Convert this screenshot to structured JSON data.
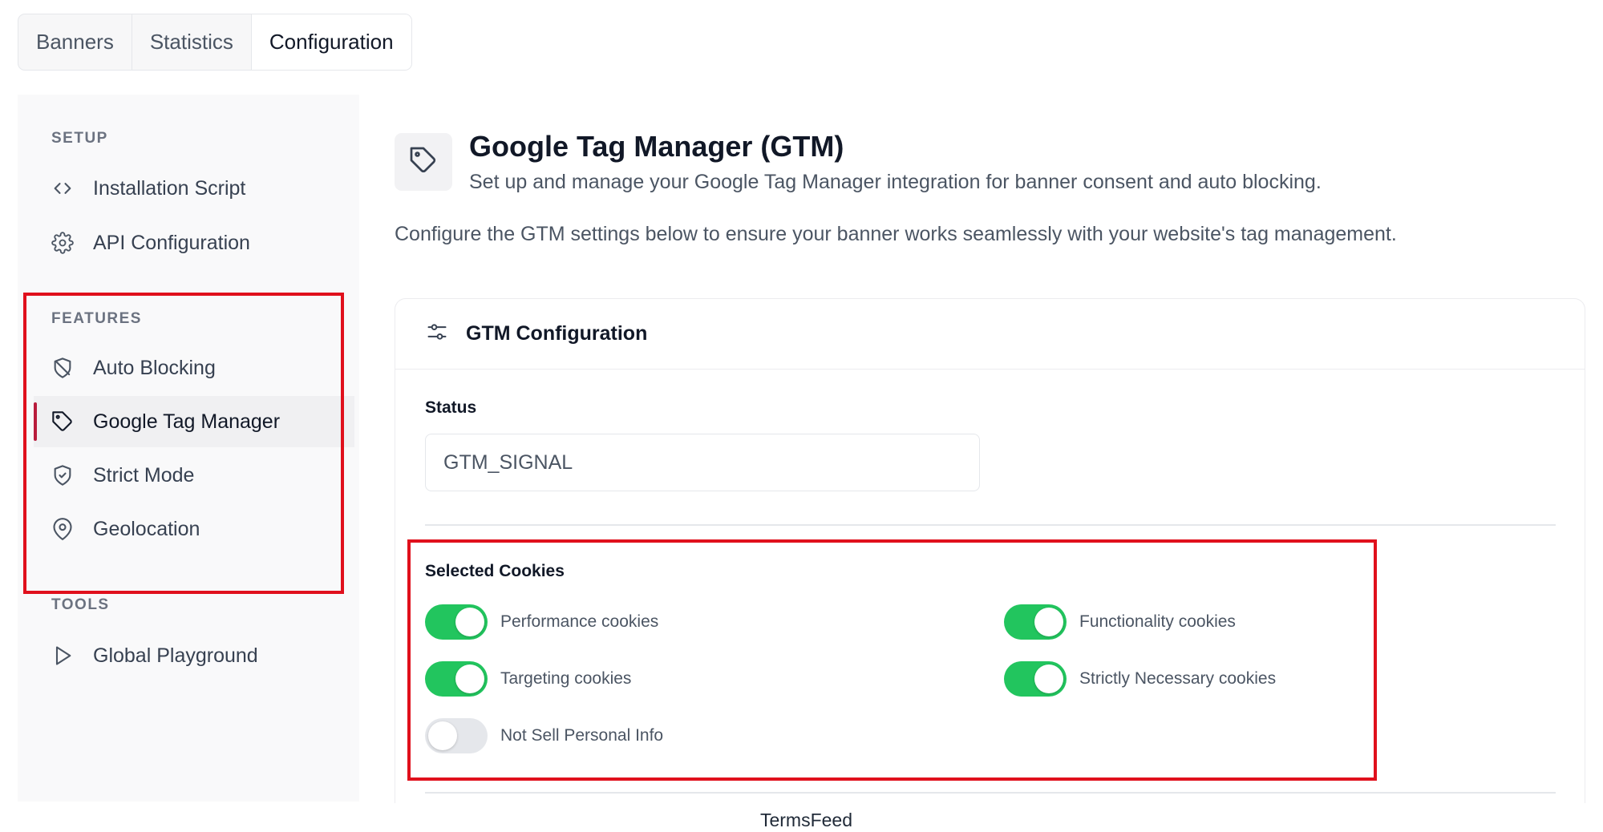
{
  "tabs": [
    {
      "label": "Banners",
      "active": false
    },
    {
      "label": "Statistics",
      "active": false
    },
    {
      "label": "Configuration",
      "active": true
    }
  ],
  "sidebar": {
    "setup_label": "SETUP",
    "features_label": "FEATURES",
    "tools_label": "TOOLS",
    "setup_items": [
      {
        "label": "Installation Script",
        "icon": "code-icon"
      },
      {
        "label": "API Configuration",
        "icon": "gear-icon"
      }
    ],
    "features_items": [
      {
        "label": "Auto Blocking",
        "icon": "shield-off-icon"
      },
      {
        "label": "Google Tag Manager",
        "icon": "tag-icon",
        "active": true
      },
      {
        "label": "Strict Mode",
        "icon": "shield-check-icon"
      },
      {
        "label": "Geolocation",
        "icon": "map-pin-icon"
      }
    ],
    "tools_items": [
      {
        "label": "Global Playground",
        "icon": "play-icon"
      }
    ]
  },
  "header": {
    "icon": "tag-icon",
    "title": "Google Tag Manager (GTM)",
    "subtitle": "Set up and manage your Google Tag Manager integration for banner consent and auto blocking.",
    "description": "Configure the GTM settings below to ensure your banner works seamlessly with your website's tag management."
  },
  "card": {
    "icon": "sliders-icon",
    "title": "GTM Configuration",
    "status_label": "Status",
    "status_value": "GTM_SIGNAL",
    "selected_cookies_label": "Selected Cookies",
    "cookies": [
      {
        "label": "Performance cookies",
        "enabled": true
      },
      {
        "label": "Functionality cookies",
        "enabled": true
      },
      {
        "label": "Targeting cookies",
        "enabled": true
      },
      {
        "label": "Strictly Necessary cookies",
        "enabled": true
      },
      {
        "label": "Not Sell Personal Info",
        "enabled": false
      }
    ]
  },
  "footer": {
    "text": "TermsFeed"
  },
  "colors": {
    "accent": "#b91c3c",
    "toggle_on": "#22c55e",
    "highlight": "#e0101c"
  }
}
